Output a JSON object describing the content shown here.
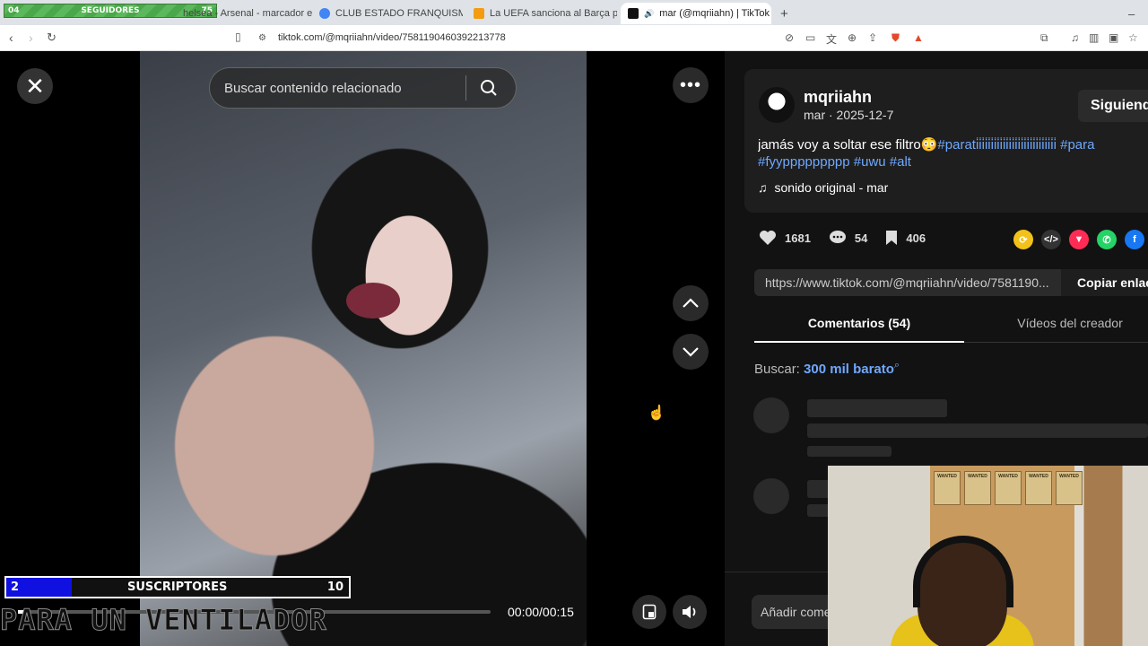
{
  "browser": {
    "overlay_bar": {
      "left": "04",
      "label": "SEGUIDORES",
      "right": "75"
    },
    "tabs": [
      {
        "title": "helsea - Arsenal - marcador en viv"
      },
      {
        "title": "CLUB ESTADO FRANQUISMO - Busca"
      },
      {
        "title": "La UEFA sanciona al Barça por los sin"
      },
      {
        "title": "mar (@mqriiahn) | TikTok"
      }
    ],
    "new_tab": "+",
    "url": "tiktok.com/@mqriiahn/video/7581190460392213778"
  },
  "video": {
    "search_placeholder": "Buscar contenido relacionado",
    "time": "00:00/00:15",
    "progress": 0.02
  },
  "overlay": {
    "subs_current": "2",
    "subs_label": "SUSCRIPTORES",
    "subs_goal": "10",
    "ticker": "PARA UN VENTILADOR"
  },
  "post": {
    "username": "mqriiahn",
    "date": "mar · 2025-12-7",
    "follow_label": "Siguiendo",
    "desc_text": "jamás voy a soltar ese filtro😳",
    "tag1": "#parati̇i̇i̇i̇i̇i̇i̇i̇i̇i̇i̇i̇i̇i̇i̇i̇i̇i̇i̇i̇i̇i̇i̇i̇i̇i̇i̇",
    "tag2": "#para",
    "line2": "#fyyppppppppp #uwu #alt",
    "sound": "sonido original - mar",
    "likes": "1681",
    "comments": "54",
    "saves": "406",
    "link": "https://www.tiktok.com/@mqriiahn/video/7581190...",
    "copy_label": "Copiar enlace",
    "tab_comments": "Comentarios (54)",
    "tab_videos": "Vídeos del creador",
    "related_prefix": "Buscar:",
    "related_query": "300 mil barato",
    "comment_placeholder": "Añadir comentario..."
  },
  "webcam": {
    "posters": [
      "WANTED",
      "WANTED",
      "WANTED",
      "WANTED",
      "WANTED"
    ]
  },
  "colors": {
    "accent_blue": "#6fa8ff",
    "subs_blue": "#1010e0",
    "follow_bg": "#2b2b2b"
  }
}
